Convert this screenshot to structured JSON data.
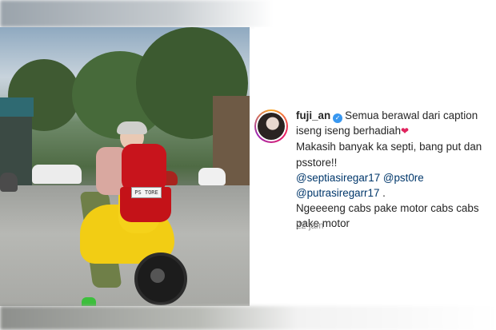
{
  "post": {
    "username": "fuji_an",
    "caption_line1": "Semua berawal dari caption iseng iseng berhadiah",
    "heart_icon": "❤",
    "caption_line2": "Makasih banyak ka septi, bang put dan psstore!!",
    "mention1": "@septiasiregar17",
    "mention2": "@pst0re",
    "mention3": "@putrasiregarr17",
    "mention_end": " .",
    "caption_line3": "Ngeeeeng cabs pake motor cabs cabs pake motor",
    "timestamp": "22 jam"
  },
  "photo": {
    "plate_text": "PS TORE"
  },
  "icons": {
    "verified": "verified-badge-icon",
    "heart": "two-hearts-emoji-icon"
  },
  "colors": {
    "verified_blue": "#3897f0",
    "mention_blue": "#00376b",
    "timestamp_gray": "#8e8e8e"
  }
}
